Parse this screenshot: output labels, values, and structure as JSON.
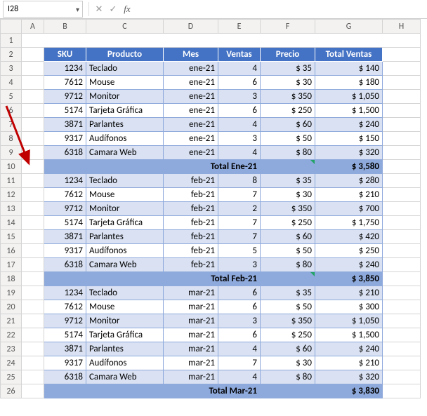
{
  "namebox": {
    "ref": "I28"
  },
  "formula_bar": {
    "cancel": "✕",
    "confirm": "✓",
    "fx": "fx",
    "value": ""
  },
  "col_headers": [
    "A",
    "B",
    "C",
    "D",
    "E",
    "F",
    "G",
    "H"
  ],
  "row_headers": [
    "1",
    "2",
    "3",
    "4",
    "5",
    "6",
    "7",
    "8",
    "9",
    "10",
    "11",
    "12",
    "13",
    "14",
    "15",
    "16",
    "17",
    "18",
    "19",
    "20",
    "21",
    "22",
    "23",
    "24",
    "25",
    "26"
  ],
  "headers": {
    "sku": "SKU",
    "producto": "Producto",
    "mes": "Mes",
    "ventas": "Ventas",
    "precio": "Precio",
    "total": "Total Ventas"
  },
  "sections": [
    {
      "total_label": "Total Ene-21",
      "total_value": "$ 3,580",
      "rows": [
        {
          "sku": "1234",
          "producto": "Teclado",
          "mes": "ene-21",
          "ventas": "4",
          "precio": "$ 35",
          "total": "$ 140"
        },
        {
          "sku": "7612",
          "producto": "Mouse",
          "mes": "ene-21",
          "ventas": "6",
          "precio": "$ 30",
          "total": "$ 180"
        },
        {
          "sku": "9712",
          "producto": "Monitor",
          "mes": "ene-21",
          "ventas": "3",
          "precio": "$ 350",
          "total": "$ 1,050"
        },
        {
          "sku": "5174",
          "producto": "Tarjeta Gráfica",
          "mes": "ene-21",
          "ventas": "6",
          "precio": "$ 250",
          "total": "$ 1,500"
        },
        {
          "sku": "3871",
          "producto": "Parlantes",
          "mes": "ene-21",
          "ventas": "4",
          "precio": "$ 60",
          "total": "$ 240"
        },
        {
          "sku": "9317",
          "producto": "Audífonos",
          "mes": "ene-21",
          "ventas": "3",
          "precio": "$ 50",
          "total": "$ 150"
        },
        {
          "sku": "6318",
          "producto": "Camara Web",
          "mes": "ene-21",
          "ventas": "4",
          "precio": "$ 80",
          "total": "$ 320"
        }
      ]
    },
    {
      "total_label": "Total Feb-21",
      "total_value": "$ 3,850",
      "rows": [
        {
          "sku": "1234",
          "producto": "Teclado",
          "mes": "feb-21",
          "ventas": "8",
          "precio": "$ 35",
          "total": "$ 280"
        },
        {
          "sku": "7612",
          "producto": "Mouse",
          "mes": "feb-21",
          "ventas": "7",
          "precio": "$ 30",
          "total": "$ 210"
        },
        {
          "sku": "9712",
          "producto": "Monitor",
          "mes": "feb-21",
          "ventas": "2",
          "precio": "$ 350",
          "total": "$ 700"
        },
        {
          "sku": "5174",
          "producto": "Tarjeta Gráfica",
          "mes": "feb-21",
          "ventas": "7",
          "precio": "$ 250",
          "total": "$ 1,750"
        },
        {
          "sku": "3871",
          "producto": "Parlantes",
          "mes": "feb-21",
          "ventas": "7",
          "precio": "$ 60",
          "total": "$ 420"
        },
        {
          "sku": "9317",
          "producto": "Audífonos",
          "mes": "feb-21",
          "ventas": "5",
          "precio": "$ 50",
          "total": "$ 250"
        },
        {
          "sku": "6318",
          "producto": "Camara Web",
          "mes": "feb-21",
          "ventas": "3",
          "precio": "$ 80",
          "total": "$ 240"
        }
      ]
    },
    {
      "total_label": "Total Mar-21",
      "total_value": "$ 3,830",
      "rows": [
        {
          "sku": "1234",
          "producto": "Teclado",
          "mes": "mar-21",
          "ventas": "6",
          "precio": "$ 35",
          "total": "$ 210"
        },
        {
          "sku": "7612",
          "producto": "Mouse",
          "mes": "mar-21",
          "ventas": "6",
          "precio": "$ 50",
          "total": "$ 300"
        },
        {
          "sku": "9712",
          "producto": "Monitor",
          "mes": "mar-21",
          "ventas": "3",
          "precio": "$ 350",
          "total": "$ 1,050"
        },
        {
          "sku": "5174",
          "producto": "Tarjeta Gráfica",
          "mes": "mar-21",
          "ventas": "6",
          "precio": "$ 250",
          "total": "$ 1,500"
        },
        {
          "sku": "3871",
          "producto": "Parlantes",
          "mes": "mar-21",
          "ventas": "4",
          "precio": "$ 60",
          "total": "$ 240"
        },
        {
          "sku": "9317",
          "producto": "Audífonos",
          "mes": "mar-21",
          "ventas": "7",
          "precio": "$ 30",
          "total": "$ 210"
        },
        {
          "sku": "6318",
          "producto": "Camara Web",
          "mes": "mar-21",
          "ventas": "4",
          "precio": "$ 80",
          "total": "$ 320"
        }
      ]
    }
  ],
  "chart_data": {
    "type": "table",
    "title": "Ventas por SKU y Mes",
    "columns": [
      "SKU",
      "Producto",
      "Mes",
      "Ventas",
      "Precio",
      "Total Ventas"
    ],
    "series": [
      {
        "name": "Total Ene-21",
        "value": 3580
      },
      {
        "name": "Total Feb-21",
        "value": 3850
      },
      {
        "name": "Total Mar-21",
        "value": 3830
      }
    ]
  }
}
